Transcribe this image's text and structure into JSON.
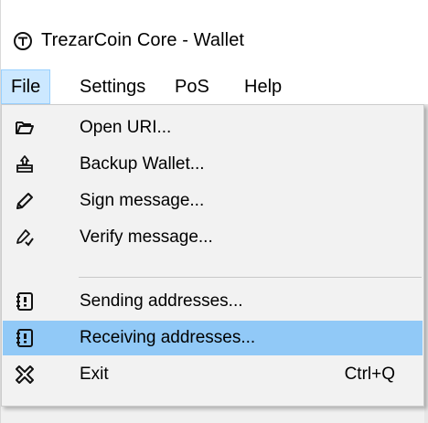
{
  "window": {
    "title": "TrezarCoin Core - Wallet"
  },
  "menubar": {
    "items": [
      {
        "label": "File"
      },
      {
        "label": "Settings"
      },
      {
        "label": "PoS"
      },
      {
        "label": "Help"
      }
    ]
  },
  "file_menu": {
    "items": [
      {
        "label": "Open URI...",
        "icon": "folder-open-icon"
      },
      {
        "label": "Backup Wallet...",
        "icon": "backup-wallet-icon"
      },
      {
        "label": "Sign message...",
        "icon": "pen-icon"
      },
      {
        "label": "Verify message...",
        "icon": "verify-icon"
      },
      {
        "label": "Sending addresses...",
        "icon": "address-book-icon"
      },
      {
        "label": "Receiving addresses...",
        "icon": "address-book-icon",
        "highlighted": true
      },
      {
        "label": "Exit",
        "icon": "exit-icon",
        "shortcut": "Ctrl+Q"
      }
    ]
  },
  "colors": {
    "highlight": "#91c9f7",
    "menubar_active": "#cce8ff",
    "menu_background": "#f2f2f2"
  }
}
